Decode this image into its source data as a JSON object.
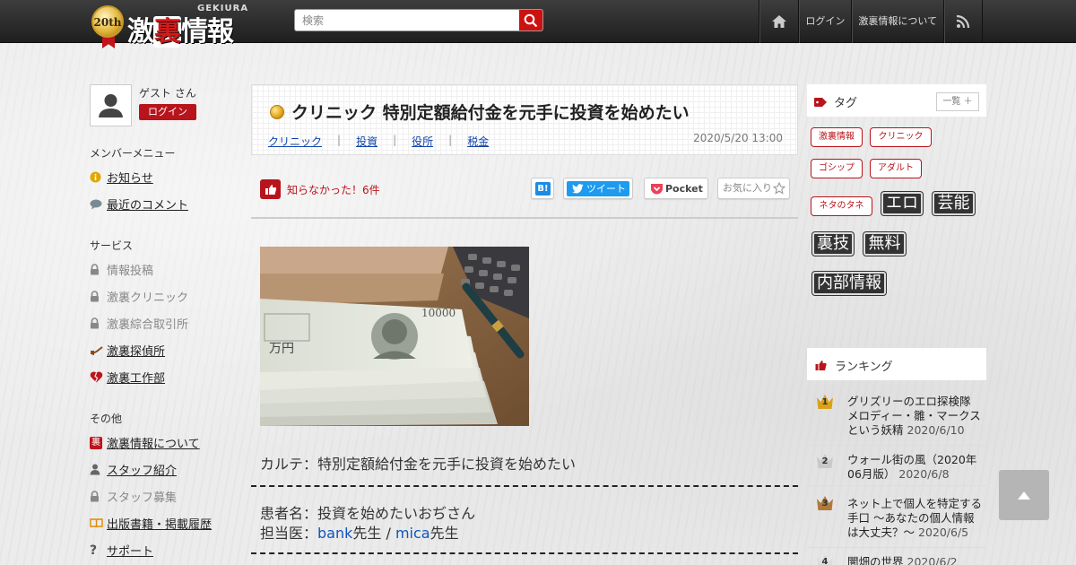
{
  "header": {
    "logo_badge": "20th",
    "logo_text_1": "激",
    "logo_text_2": "裏",
    "logo_text_3": "情報",
    "logo_sub": "GEKIURA",
    "search_placeholder": "検索",
    "nav": {
      "login": "ログイン",
      "about": "激裏情報について"
    }
  },
  "user": {
    "name": "ゲスト さん",
    "login_button": "ログイン"
  },
  "sidebar": {
    "member_heading": "メンバーメニュー",
    "member_items": [
      {
        "label": "お知らせ",
        "icon": "info-icon"
      },
      {
        "label": "最近のコメント",
        "icon": "comment-icon"
      }
    ],
    "service_heading": "サービス",
    "service_items": [
      {
        "label": "情報投稿",
        "icon": "lock-icon"
      },
      {
        "label": "激裏クリニック",
        "icon": "lock-icon"
      },
      {
        "label": "激裏綜合取引所",
        "icon": "lock-icon"
      },
      {
        "label": "激裏探偵所",
        "icon": "pipe-icon"
      },
      {
        "label": "激裏工作部",
        "icon": "broken-heart-icon"
      }
    ],
    "other_heading": "その他",
    "other_items": [
      {
        "label": "激裏情報について",
        "icon": "gekiura-icon"
      },
      {
        "label": "スタッフ紹介",
        "icon": "person-icon"
      },
      {
        "label": "スタッフ募集",
        "icon": "lock-icon"
      },
      {
        "label": "出版書籍・掲載履歴",
        "icon": "book-icon"
      },
      {
        "label": "サポート",
        "icon": "question-icon"
      }
    ]
  },
  "article": {
    "title": "クリニック 特別定額給付金を元手に投資を始めたい",
    "categories": [
      "クリニック",
      "投資",
      "役所",
      "税金"
    ],
    "date": "2020/5/20 13:00",
    "reaction": "知らなかった！6件",
    "share": {
      "hatena": "B!",
      "tweet": "ツイート",
      "pocket": "Pocket",
      "favorite": "お気に入り"
    },
    "karte": "カルテ：特別定額給付金を元手に投資を始めたい",
    "patient": "患者名：投資を始めたいおぢさん",
    "doctor_prefix": "担当医：",
    "doctor1": "bank",
    "doctor_suffix1": "先生",
    "doctor_sep": " / ",
    "doctor2": "mica",
    "doctor_suffix2": "先生"
  },
  "tags": {
    "heading": "タグ",
    "list_button": "一覧 ＋",
    "small": [
      "激裏情報",
      "クリニック",
      "ゴシップ",
      "アダルト",
      "ネタのタネ"
    ],
    "big": [
      "エロ",
      "芸能",
      "裏技",
      "無料",
      "内部情報"
    ]
  },
  "ranking": {
    "heading": "ランキング",
    "items": [
      {
        "rank": "1",
        "title": "グリズリーのエロ探検隊 メロディー・雛・マークスという妖精",
        "date": "2020/6/10",
        "color": "#d9a21b"
      },
      {
        "rank": "2",
        "title": "ウォール街の風（2020年06月版）",
        "date": "2020/6/8",
        "color": "#c9c9c9"
      },
      {
        "rank": "3",
        "title": "ネット上で個人を特定する手口 ～あなたの個人情報は大丈夫？～",
        "date": "2020/6/5",
        "color": "#b07a3a"
      },
      {
        "rank": "4",
        "title": "闇畑の世界",
        "date": "2020/6/2",
        "color": "#dddddd"
      }
    ]
  }
}
